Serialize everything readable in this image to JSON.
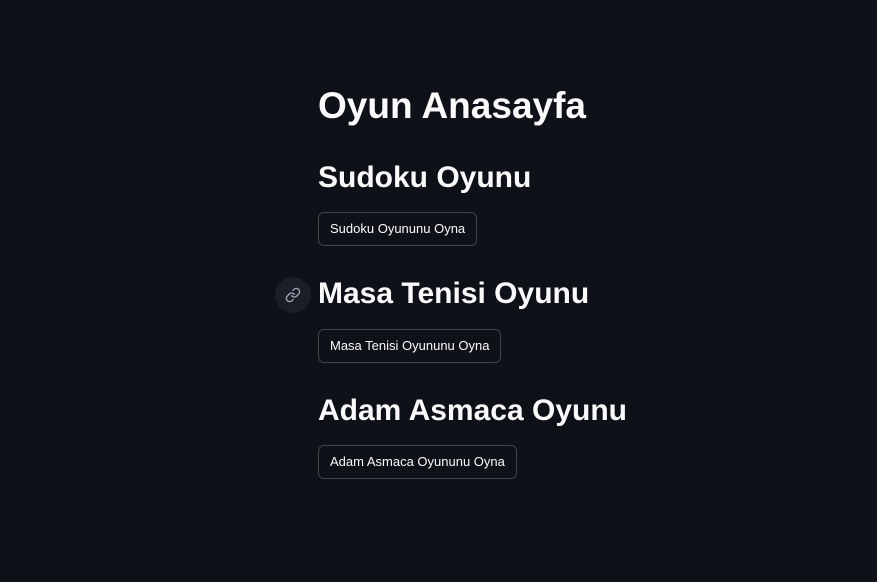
{
  "page": {
    "title": "Oyun Anasayfa"
  },
  "games": [
    {
      "heading": "Sudoku Oyunu",
      "button_label": "Sudoku Oyununu Oyna"
    },
    {
      "heading": "Masa Tenisi Oyunu",
      "button_label": "Masa Tenisi Oyununu Oyna"
    },
    {
      "heading": "Adam Asmaca Oyunu",
      "button_label": "Adam Asmaca Oyununu Oyna"
    }
  ],
  "icons": {
    "heading_anchor": "link-icon"
  },
  "colors": {
    "background": "#0e1117",
    "text": "#fafafa",
    "button_border": "#45474d",
    "anchor_bg": "#1b1e26"
  }
}
